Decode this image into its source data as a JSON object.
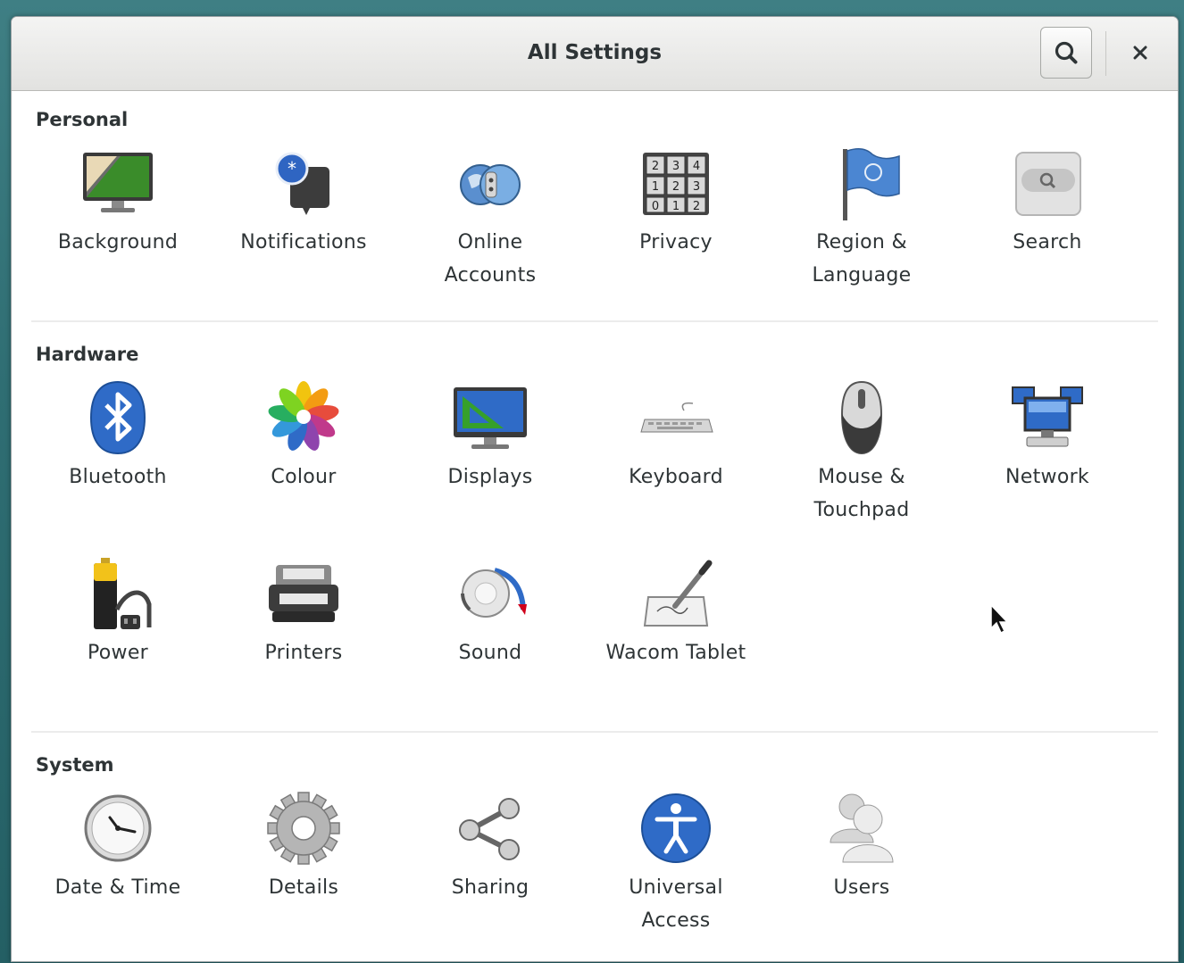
{
  "window": {
    "title": "All Settings",
    "search_icon": "search-icon",
    "close_icon": "close-icon"
  },
  "sections": {
    "personal": {
      "title": "Personal",
      "items": [
        {
          "label": "Background",
          "icon": "background-icon"
        },
        {
          "label": "Notifications",
          "icon": "notifications-icon"
        },
        {
          "label": "Online\nAccounts",
          "icon": "online-accounts-icon"
        },
        {
          "label": "Privacy",
          "icon": "privacy-icon"
        },
        {
          "label": "Region &\nLanguage",
          "icon": "region-language-icon"
        },
        {
          "label": "Search",
          "icon": "search-settings-icon"
        }
      ]
    },
    "hardware": {
      "title": "Hardware",
      "items": [
        {
          "label": "Bluetooth",
          "icon": "bluetooth-icon"
        },
        {
          "label": "Colour",
          "icon": "colour-icon"
        },
        {
          "label": "Displays",
          "icon": "displays-icon"
        },
        {
          "label": "Keyboard",
          "icon": "keyboard-icon"
        },
        {
          "label": "Mouse &\nTouchpad",
          "icon": "mouse-icon"
        },
        {
          "label": "Network",
          "icon": "network-icon"
        },
        {
          "label": "Power",
          "icon": "power-icon"
        },
        {
          "label": "Printers",
          "icon": "printer-icon"
        },
        {
          "label": "Sound",
          "icon": "sound-icon"
        },
        {
          "label": "Wacom Tablet",
          "icon": "wacom-tablet-icon"
        }
      ]
    },
    "system": {
      "title": "System",
      "items": [
        {
          "label": "Date & Time",
          "icon": "clock-icon"
        },
        {
          "label": "Details",
          "icon": "gear-icon"
        },
        {
          "label": "Sharing",
          "icon": "share-icon"
        },
        {
          "label": "Universal\nAccess",
          "icon": "universal-access-icon"
        },
        {
          "label": "Users",
          "icon": "users-icon"
        }
      ]
    }
  }
}
